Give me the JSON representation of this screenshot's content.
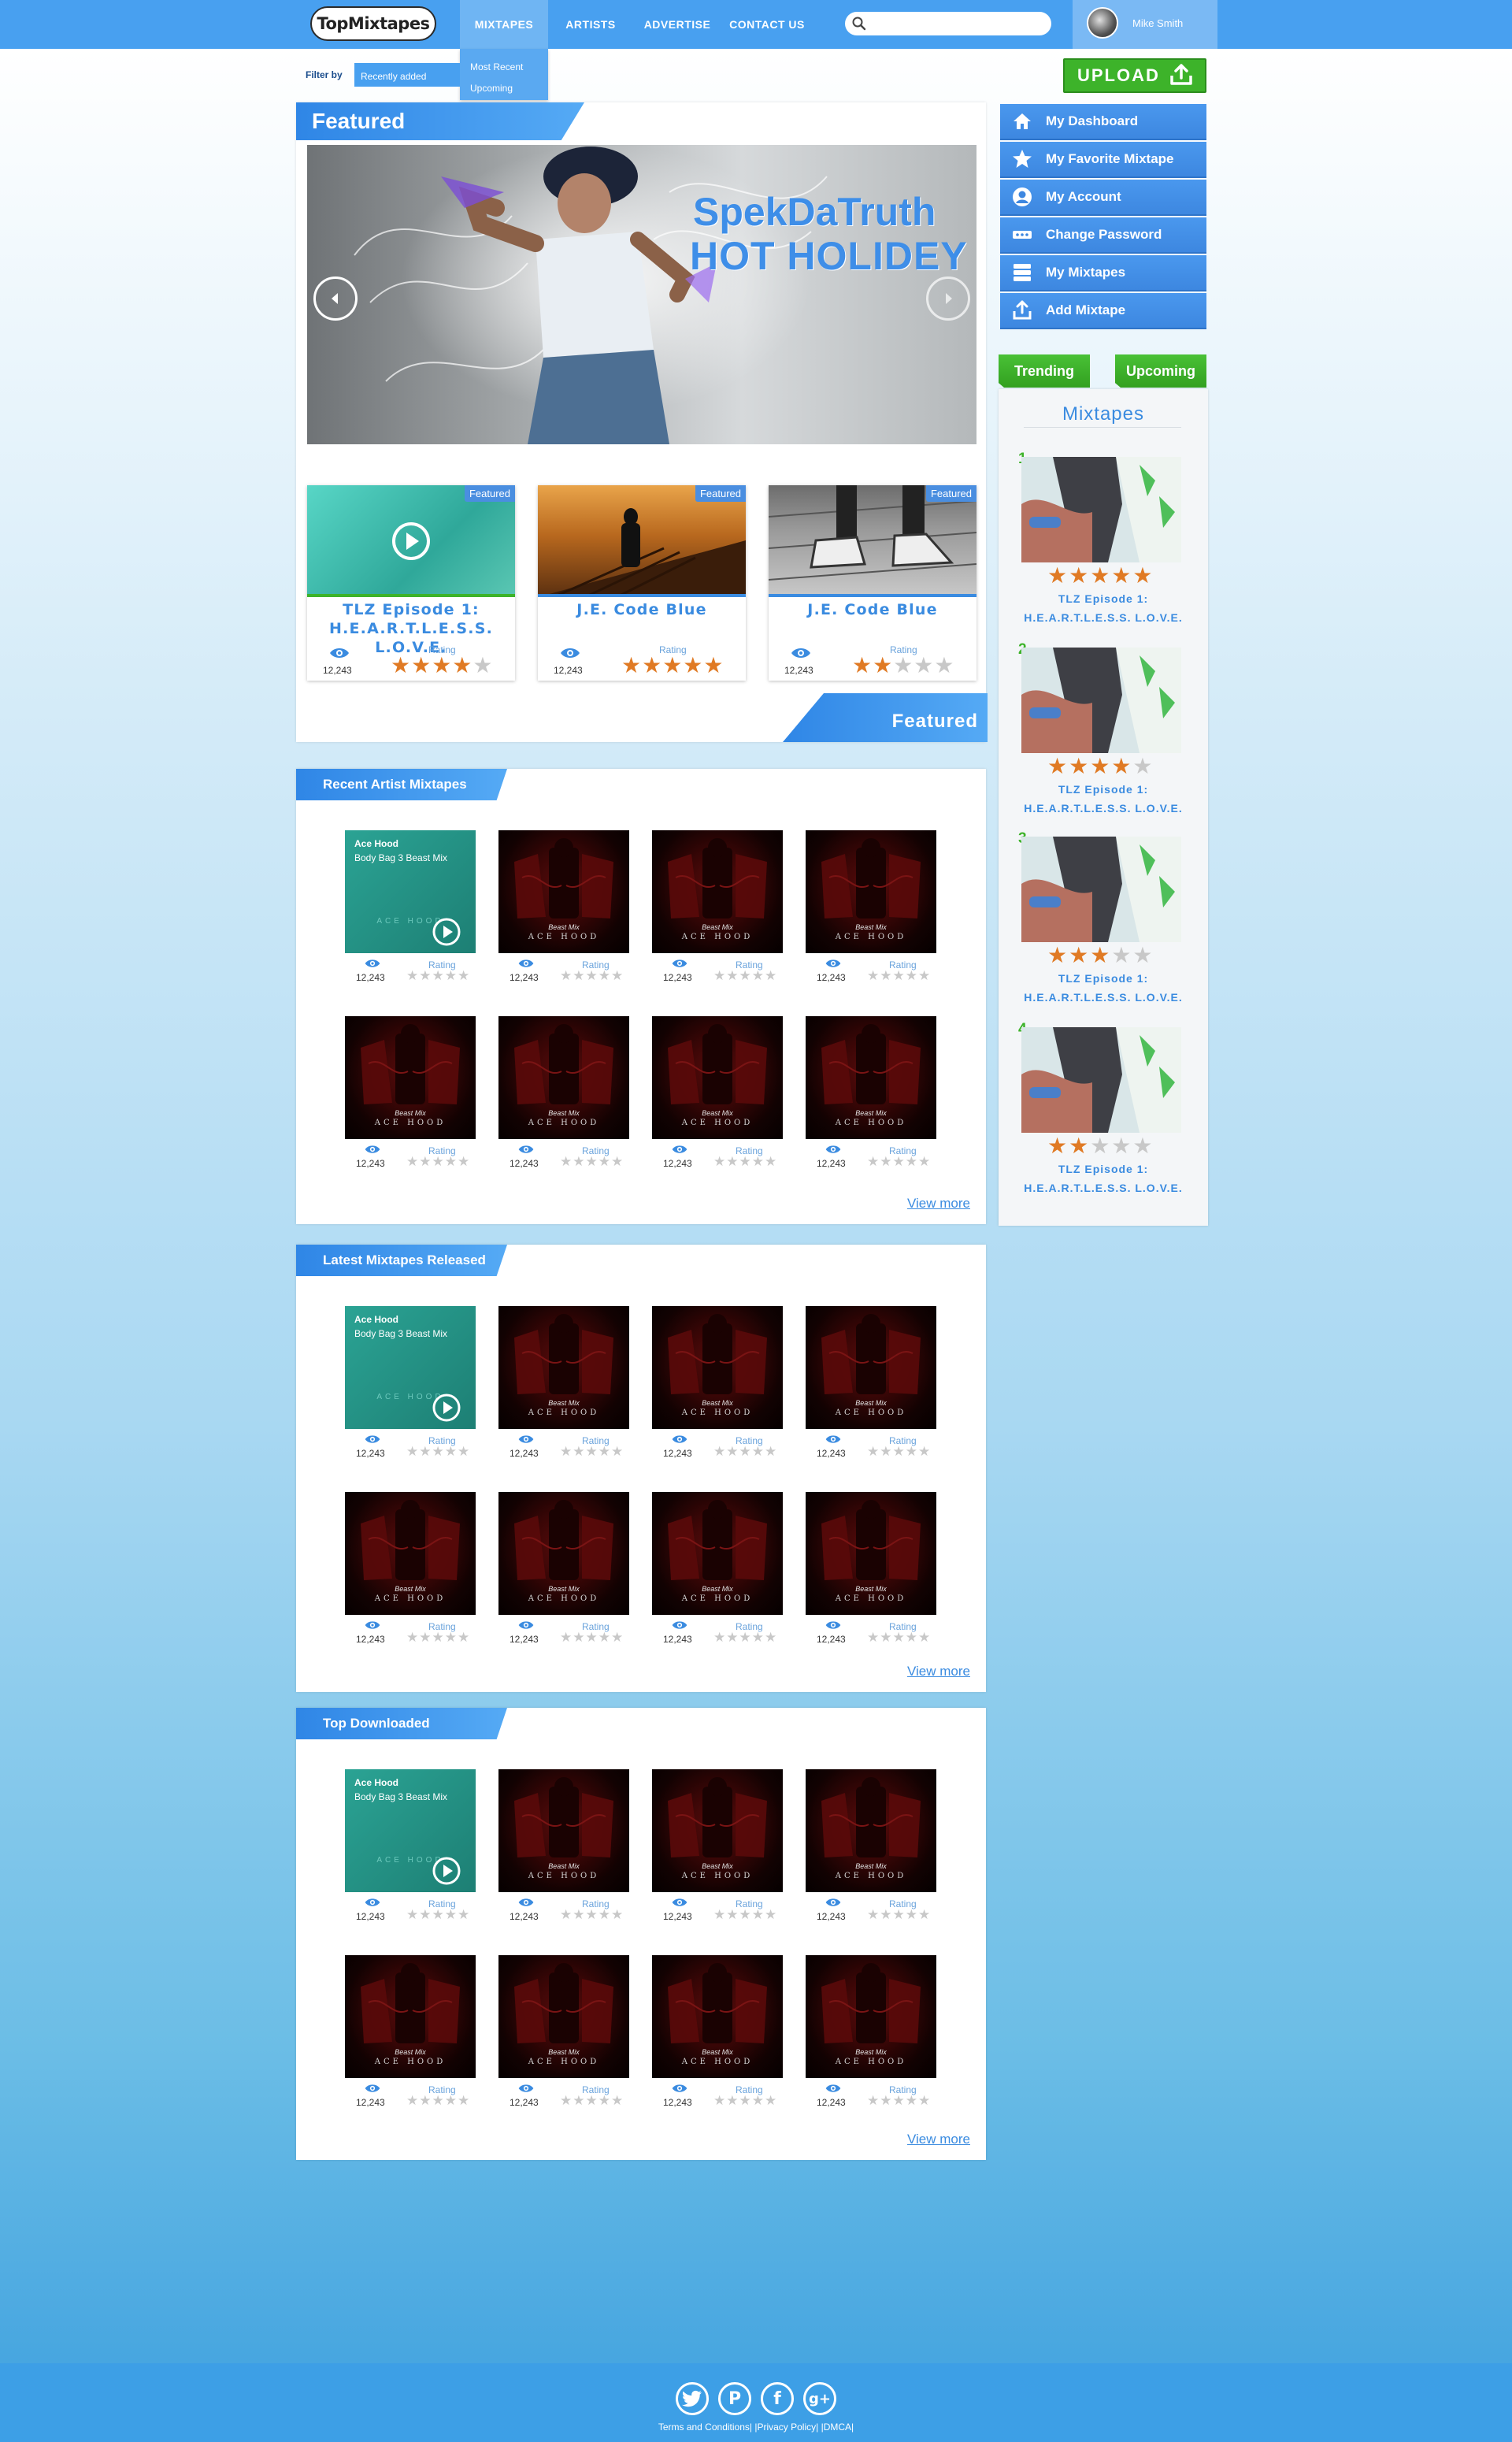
{
  "nav": {
    "logo": "TopMixtapes",
    "items": [
      "MIXTAPES",
      "ARTISTS",
      "ADVERTISE",
      "CONTACT US"
    ],
    "search_placeholder": "",
    "user_name": "Mike Smith",
    "dropdown": [
      "Most Recent",
      "Upcoming"
    ]
  },
  "filter": {
    "label": "Filter by",
    "selected": "Recently added"
  },
  "upload": {
    "label": "UPLOAD"
  },
  "featured": {
    "heading": "Featured",
    "footer_label": "Featured",
    "banner_title": "SpekDaTruth",
    "banner_subtitle": "HOT HOLIDEY",
    "cards": [
      {
        "badge": "Featured",
        "title_line1": "TLZ Episode 1:",
        "title_line2": "H.E.A.R.T.L.E.S.S. L.O.V.E.",
        "views": "12,243",
        "rating_label": "Rating",
        "rating": 4
      },
      {
        "badge": "Featured",
        "title_line1": "J.E. Code Blue",
        "title_line2": "",
        "views": "12,243",
        "rating_label": "Rating",
        "rating": 5
      },
      {
        "badge": "Featured",
        "title_line1": "J.E. Code Blue",
        "title_line2": "",
        "views": "12,243",
        "rating_label": "Rating",
        "rating": 2
      }
    ]
  },
  "sections": [
    {
      "heading": "Recent Artist Mixtapes",
      "view_more": "View more"
    },
    {
      "heading": "Latest Mixtapes Released",
      "view_more": "View more"
    },
    {
      "heading": "Top Downloaded",
      "view_more": "View more"
    }
  ],
  "tile": {
    "artist": "Ace Hood",
    "album": "Body Bag 3 Beast Mix",
    "cover_text": "ACE HOOD",
    "cover_script": "Beast Mix",
    "views": "12,243",
    "rating_label": "Rating"
  },
  "sidebar": {
    "menu": [
      "My Dashboard",
      "My Favorite Mixtape",
      "My Account",
      "Change Password",
      "My Mixtapes",
      "Add Mixtape"
    ],
    "tabs": [
      "Trending",
      "Upcoming"
    ],
    "panel_title": "Mixtapes",
    "ranked": [
      {
        "rank": "1",
        "title_line1": "TLZ Episode 1:",
        "title_line2": "H.E.A.R.T.L.E.S.S. L.O.V.E.",
        "rating": 5
      },
      {
        "rank": "2",
        "title_line1": "TLZ Episode 1:",
        "title_line2": "H.E.A.R.T.L.E.S.S. L.O.V.E.",
        "rating": 4
      },
      {
        "rank": "3",
        "title_line1": "TLZ Episode 1:",
        "title_line2": "H.E.A.R.T.L.E.S.S. L.O.V.E.",
        "rating": 3
      },
      {
        "rank": "4",
        "title_line1": "TLZ Episode 1:",
        "title_line2": "H.E.A.R.T.L.E.S.S. L.O.V.E.",
        "rating": 2
      }
    ]
  },
  "footer": {
    "social": [
      "twitter-icon",
      "pinterest-icon",
      "facebook-icon",
      "google-plus-icon"
    ],
    "links": "Terms and Conditions| |Privacy Policy| |DMCA|"
  },
  "colors": {
    "primary": "#48a0f0",
    "accent_green": "#3db32a",
    "star": "#e07a24",
    "link": "#3a8be0"
  }
}
